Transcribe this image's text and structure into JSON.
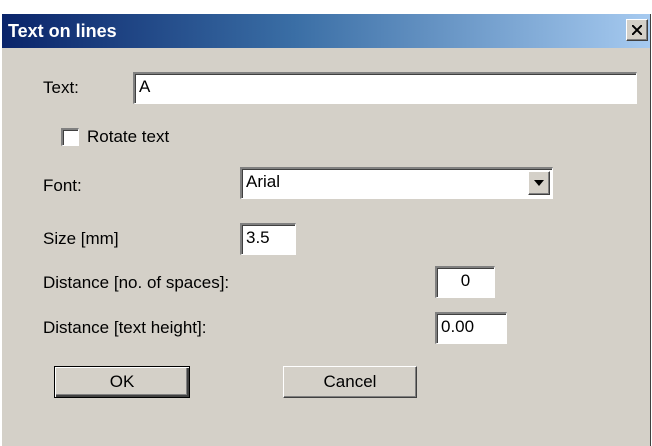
{
  "window": {
    "title": "Text on lines",
    "close_glyph": "X"
  },
  "form": {
    "text_label": "Text:",
    "text_value": "A",
    "rotate_label": "Rotate text",
    "rotate_checked": false,
    "font_label": "Font:",
    "font_value": "Arial",
    "size_label": "Size  [mm]",
    "size_value": "3.5",
    "distance_spaces_label": "Distance [no. of spaces]:",
    "distance_spaces_value": "0",
    "distance_height_label": "Distance [text height]:",
    "distance_height_value": "0.00"
  },
  "buttons": {
    "ok": "OK",
    "cancel": "Cancel"
  },
  "icons": {
    "close": "close-icon",
    "dropdown": "chevron-down-icon"
  },
  "colors": {
    "titlebar_start": "#0a246a",
    "titlebar_end": "#a6caf0",
    "dialog_bg": "#d4d0c8"
  }
}
